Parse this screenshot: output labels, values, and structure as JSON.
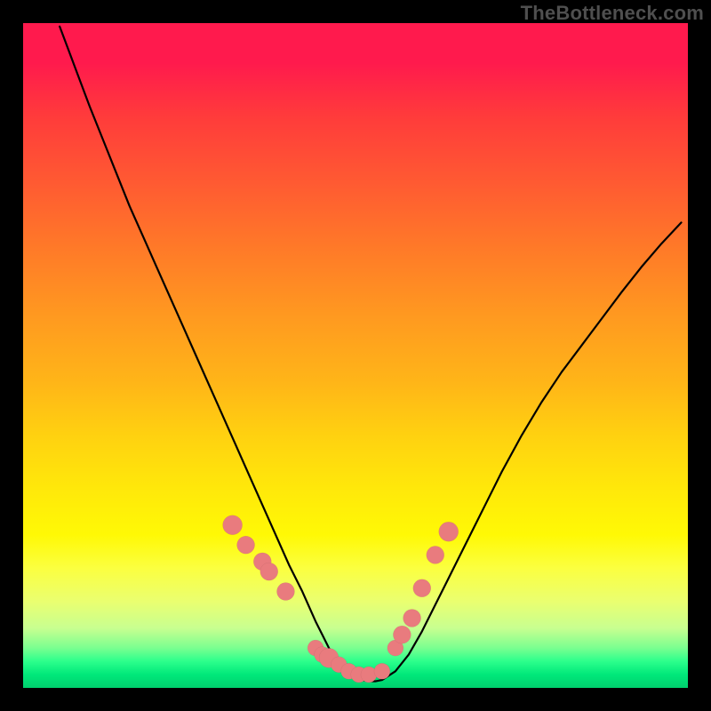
{
  "watermark": "TheBottleneck.com",
  "chart_data": {
    "type": "line",
    "title": "",
    "xlabel": "",
    "ylabel": "",
    "xlim": [
      0,
      1
    ],
    "ylim": [
      0,
      1
    ],
    "series": [
      {
        "name": "curve",
        "x": [
          0.055,
          0.07,
          0.085,
          0.1,
          0.12,
          0.14,
          0.16,
          0.18,
          0.2,
          0.22,
          0.24,
          0.26,
          0.28,
          0.3,
          0.32,
          0.34,
          0.36,
          0.38,
          0.4,
          0.42,
          0.44,
          0.45,
          0.46,
          0.47,
          0.48,
          0.49,
          0.5,
          0.51,
          0.52,
          0.53,
          0.54,
          0.56,
          0.58,
          0.6,
          0.62,
          0.64,
          0.66,
          0.68,
          0.7,
          0.72,
          0.75,
          0.78,
          0.81,
          0.84,
          0.87,
          0.9,
          0.93,
          0.96,
          0.99
        ],
        "y": [
          0.995,
          0.955,
          0.915,
          0.875,
          0.825,
          0.775,
          0.725,
          0.68,
          0.635,
          0.59,
          0.545,
          0.5,
          0.455,
          0.41,
          0.365,
          0.32,
          0.275,
          0.23,
          0.185,
          0.145,
          0.1,
          0.08,
          0.06,
          0.045,
          0.03,
          0.02,
          0.015,
          0.012,
          0.01,
          0.01,
          0.012,
          0.025,
          0.05,
          0.085,
          0.125,
          0.165,
          0.205,
          0.245,
          0.285,
          0.325,
          0.38,
          0.43,
          0.475,
          0.515,
          0.555,
          0.595,
          0.633,
          0.668,
          0.7
        ]
      }
    ],
    "scatter": {
      "name": "dots",
      "x": [
        0.315,
        0.335,
        0.36,
        0.37,
        0.395,
        0.44,
        0.45,
        0.46,
        0.475,
        0.49,
        0.505,
        0.52,
        0.54,
        0.56,
        0.57,
        0.585,
        0.6,
        0.62,
        0.64
      ],
      "y": [
        0.245,
        0.215,
        0.19,
        0.175,
        0.145,
        0.06,
        0.05,
        0.045,
        0.035,
        0.025,
        0.02,
        0.02,
        0.025,
        0.06,
        0.08,
        0.105,
        0.15,
        0.2,
        0.235
      ],
      "r": [
        11,
        10,
        10,
        10,
        10,
        9,
        9,
        11,
        9,
        9,
        9,
        9,
        9,
        9,
        10,
        10,
        10,
        10,
        11
      ]
    },
    "colors": {
      "curve": "#000000",
      "dots": "#e97b7e"
    }
  }
}
